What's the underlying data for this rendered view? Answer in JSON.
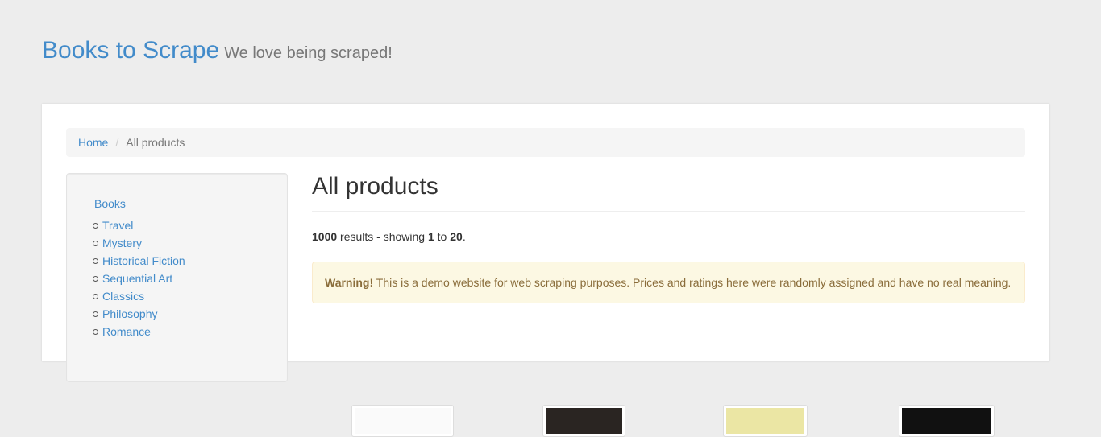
{
  "header": {
    "brand": "Books to Scrape",
    "tagline": "We love being scraped!"
  },
  "breadcrumb": {
    "items": [
      "Home",
      "All products"
    ],
    "separator": "/"
  },
  "sidebar": {
    "root_label": "Books",
    "categories": [
      "Travel",
      "Mystery",
      "Historical Fiction",
      "Sequential Art",
      "Classics",
      "Philosophy",
      "Romance"
    ]
  },
  "main": {
    "title": "All products",
    "results": {
      "total": "1000",
      "text_mid": "results - showing",
      "from": "1",
      "to_word": "to",
      "to": "20",
      "end": "."
    },
    "alert": {
      "strong": "Warning!",
      "message": "This is a demo website for web scraping purposes. Prices and ratings here were randomly assigned and have no real meaning."
    }
  },
  "colors": {
    "link": "#428bca",
    "background": "#ededed",
    "alert_bg": "#fcf8e3",
    "alert_text": "#8a6d3b"
  }
}
